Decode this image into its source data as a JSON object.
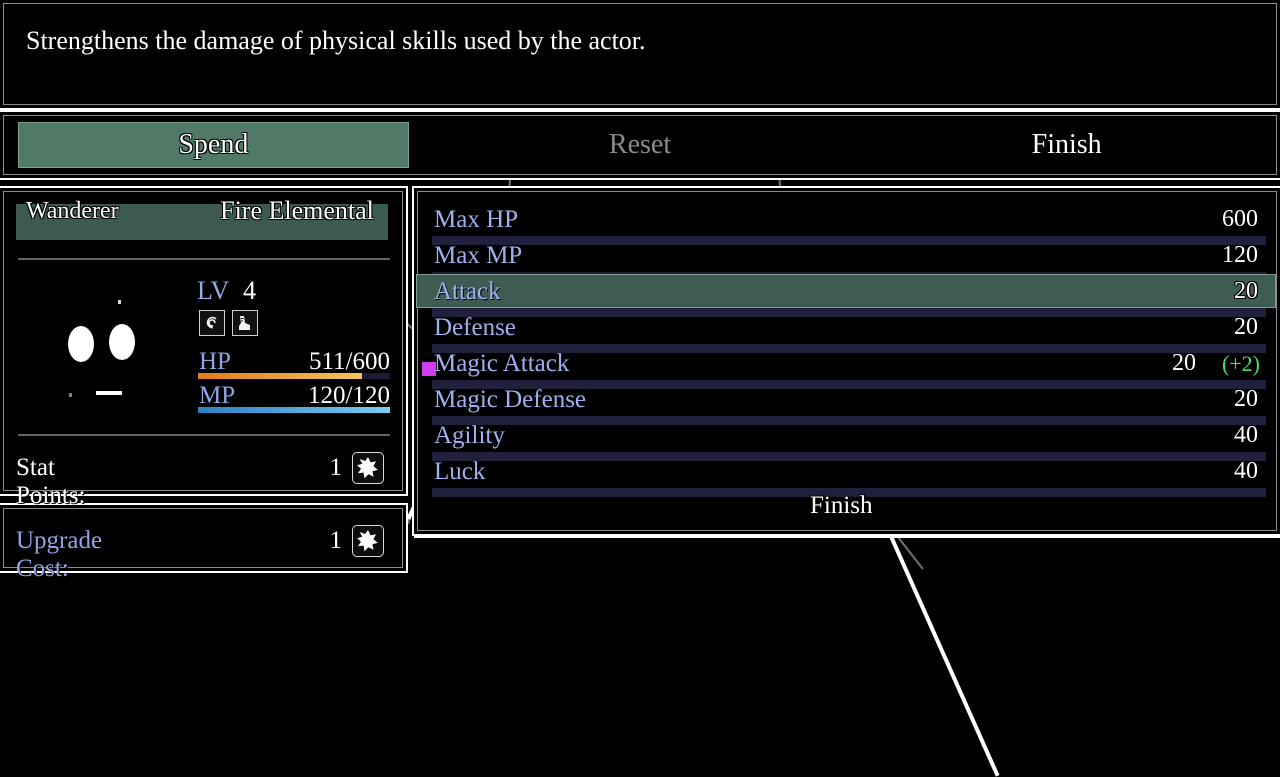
{
  "help": {
    "text": "Strengthens the damage of physical skills used by the actor."
  },
  "command": {
    "items": [
      {
        "label": "Spend",
        "state": "selected"
      },
      {
        "label": "Reset",
        "state": "disabled"
      },
      {
        "label": "Finish",
        "state": "normal"
      }
    ]
  },
  "status": {
    "class_name": "Wanderer",
    "character_name": "Fire Elemental",
    "level_label": "LV",
    "level_value": "4",
    "state_icons": [
      {
        "name": "state-icon-spiral",
        "glyph": "@"
      },
      {
        "name": "state-icon-boot",
        "glyph": "✽"
      }
    ],
    "hp": {
      "label": "HP",
      "value": "511/600",
      "current": 511,
      "max": 600,
      "color": "#f0a02a"
    },
    "mp": {
      "label": "MP",
      "value": "120/120",
      "current": 120,
      "max": 120,
      "color": "#5bbbe8"
    },
    "stat_points": {
      "label": "Stat Points:",
      "value": "1",
      "icon": "star-burst-icon",
      "icon_glyph": "✸"
    }
  },
  "cost": {
    "label": "Upgrade Cost:",
    "value": "1",
    "icon": "star-burst-icon",
    "icon_glyph": "✸"
  },
  "stats": {
    "rows": [
      {
        "name": "Max HP",
        "value": "600",
        "bonus": "",
        "selected": false,
        "cursor": false
      },
      {
        "name": "Max MP",
        "value": "120",
        "bonus": "",
        "selected": false,
        "cursor": false
      },
      {
        "name": "Attack",
        "value": "20",
        "bonus": "",
        "selected": true,
        "cursor": false
      },
      {
        "name": "Defense",
        "value": "20",
        "bonus": "",
        "selected": false,
        "cursor": false
      },
      {
        "name": "Magic Attack",
        "value": "20",
        "bonus": "(+2)",
        "selected": false,
        "cursor": true
      },
      {
        "name": "Magic Defense",
        "value": "20",
        "bonus": "",
        "selected": false,
        "cursor": false
      },
      {
        "name": "Agility",
        "value": "40",
        "bonus": "",
        "selected": false,
        "cursor": false
      },
      {
        "name": "Luck",
        "value": "40",
        "bonus": "",
        "selected": false,
        "cursor": false
      }
    ]
  },
  "overlay": {
    "finish_label": "Finish"
  },
  "colors": {
    "selection": "#507968",
    "stat_label": "#9fb0ee",
    "bonus_positive": "#49e06a",
    "cursor": "#d13df0",
    "gauge_back": "#20203c",
    "hp_fill": "#f0a02a",
    "mp_fill": "#5bbbe8",
    "window_border": "#ffffff",
    "header_band": "#3c5a50"
  }
}
